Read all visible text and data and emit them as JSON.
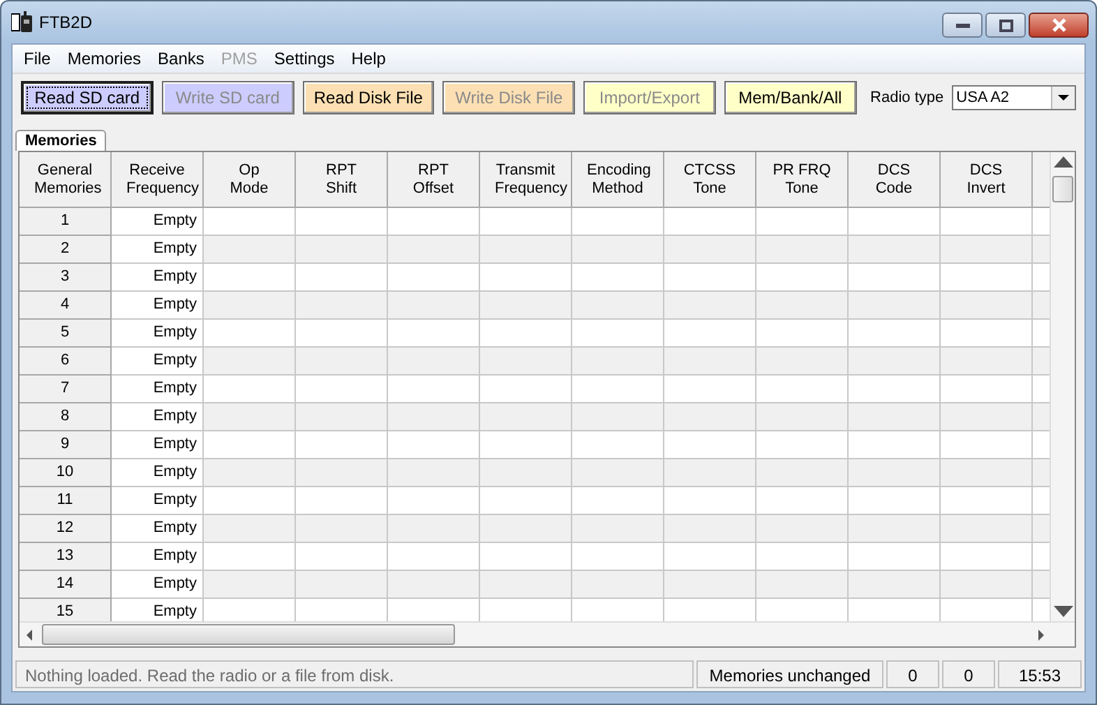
{
  "window": {
    "title": "FTB2D"
  },
  "menu": [
    {
      "label": "File",
      "disabled": false
    },
    {
      "label": "Memories",
      "disabled": false
    },
    {
      "label": "Banks",
      "disabled": false
    },
    {
      "label": "PMS",
      "disabled": true
    },
    {
      "label": "Settings",
      "disabled": false
    },
    {
      "label": "Help",
      "disabled": false
    }
  ],
  "toolbar": {
    "buttons": [
      {
        "label": "Read SD card",
        "color": "#ccccff",
        "disabled": false,
        "focused": true
      },
      {
        "label": "Write SD card",
        "color": "#ccccff",
        "disabled": true,
        "focused": false
      },
      {
        "label": "Read Disk File",
        "color": "#fce0b4",
        "disabled": false,
        "focused": false
      },
      {
        "label": "Write Disk File",
        "color": "#fce0b4",
        "disabled": true,
        "focused": false
      },
      {
        "label": "Import/Export",
        "color": "#ffffc8",
        "disabled": true,
        "focused": false
      },
      {
        "label": "Mem/Bank/All",
        "color": "#ffffc8",
        "disabled": false,
        "focused": false
      }
    ],
    "radio_type": {
      "label": "Radio type",
      "value": "USA A2"
    }
  },
  "tabs": [
    {
      "label": "Memories",
      "selected": true
    }
  ],
  "table": {
    "columns": [
      "General Memories",
      "Receive Frequency",
      "Op Mode",
      "RPT Shift",
      "RPT Offset",
      "Transmit Frequency",
      "Encoding Method",
      "CTCSS Tone",
      "PR FRQ Tone",
      "DCS Code",
      "DCS Invert"
    ],
    "rows": [
      {
        "number": "1",
        "receive_frequency": "Empty"
      },
      {
        "number": "2",
        "receive_frequency": "Empty"
      },
      {
        "number": "3",
        "receive_frequency": "Empty"
      },
      {
        "number": "4",
        "receive_frequency": "Empty"
      },
      {
        "number": "5",
        "receive_frequency": "Empty"
      },
      {
        "number": "6",
        "receive_frequency": "Empty"
      },
      {
        "number": "7",
        "receive_frequency": "Empty"
      },
      {
        "number": "8",
        "receive_frequency": "Empty"
      },
      {
        "number": "9",
        "receive_frequency": "Empty"
      },
      {
        "number": "10",
        "receive_frequency": "Empty"
      },
      {
        "number": "11",
        "receive_frequency": "Empty"
      },
      {
        "number": "12",
        "receive_frequency": "Empty"
      },
      {
        "number": "13",
        "receive_frequency": "Empty"
      },
      {
        "number": "14",
        "receive_frequency": "Empty"
      },
      {
        "number": "15",
        "receive_frequency": "Empty"
      }
    ]
  },
  "status_bar": {
    "message": "Nothing loaded. Read the radio or a file from disk.",
    "state": "Memories unchanged",
    "count_1": "0",
    "count_2": "0",
    "time": "15:53"
  }
}
